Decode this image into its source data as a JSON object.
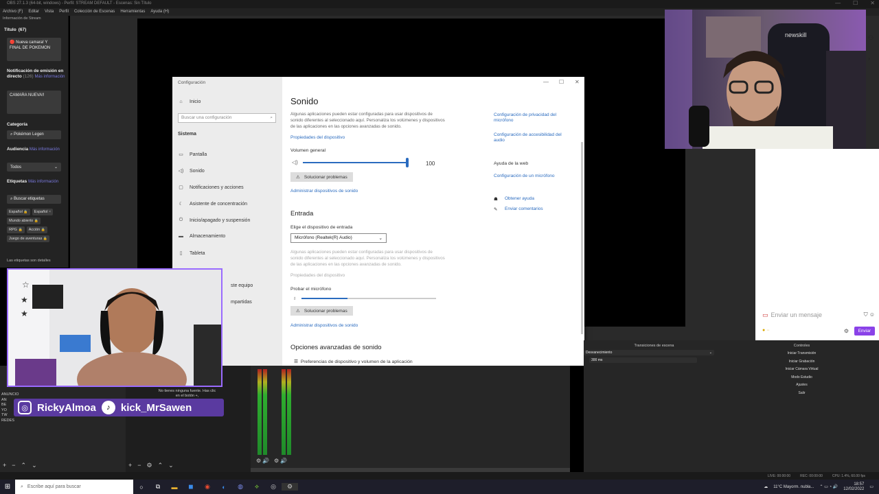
{
  "obs": {
    "title": "OBS 27.1.3 (64-bit, windows) - Perfil: STREAM DEFAULT - Escenas: Sin Título",
    "menu": [
      "Archivo (F)",
      "Editar",
      "Vista",
      "Perfil",
      "Colección de Escenas",
      "Herramientas",
      "Ayuda (H)"
    ]
  },
  "stream_info": {
    "header": "Información de Stream",
    "title_label": "Título",
    "title_count": "(67)",
    "title_value": "🔴 Nueva camara! Y FINAL DE POKEMON",
    "notif_label": "Notificación de emisión en directo",
    "notif_count": "(126)",
    "more": "Más información",
    "notif_value": "CAMARA NUEVA!!",
    "category_label": "Categoría",
    "category_value": "Pokémon Legen",
    "audience_label": "Audiencia",
    "audience_value": "Todos",
    "tags_label": "Etiquetas",
    "tags_search": "Buscar etiquetas",
    "tags": [
      "Español",
      "Español",
      "Mundo abierto",
      "RPG",
      "Acción",
      "Juego de aventuras"
    ],
    "tags_note": "Las etiquetas son detalles"
  },
  "settings": {
    "window_title": "Configuración",
    "home": "Inicio",
    "search_placeholder": "Buscar una configuración",
    "section": "Sistema",
    "nav": [
      "Pantalla",
      "Sonido",
      "Notificaciones y acciones",
      "Asistente de concentración",
      "Inicio/apagado y suspensión",
      "Almacenamiento",
      "Tableta"
    ],
    "nav_partial": [
      "ste equipo",
      "mpartidas"
    ],
    "page_title": "Sonido",
    "output_desc": "Algunas aplicaciones pueden estar configuradas para usar dispositivos de sonido diferentes al seleccionado aquí. Personaliza los volúmenes y dispositivos de las aplicaciones en las opciones avanzadas de sonido.",
    "device_props": "Propiedades del dispositivo",
    "volume_label": "Volumen general",
    "volume_value": "100",
    "troubleshoot": "Solucionar problemas",
    "manage_devices": "Administrar dispositivos de sonido",
    "input_header": "Entrada",
    "input_choose": "Elige el dispositivo de entrada",
    "input_device": "Micrófono (Realtek(R) Audio)",
    "input_desc": "Algunas aplicaciones pueden estar configuradas para usar dispositivos de sonido diferentes al seleccionado aquí. Personaliza los volúmenes y dispositivos de las aplicaciones en las opciones avanzadas de sonido.",
    "input_props": "Propiedades del dispositivo",
    "test_mic": "Probar el micrófono",
    "mic_level": 0.34,
    "troubleshoot2": "Solucionar problemas",
    "manage_devices2": "Administrar dispositivos de sonido",
    "advanced_header": "Opciones avanzadas de sonido",
    "app_prefs": "Preferencias de dispositivo y volumen de la aplicación",
    "related": [
      "Configuración de privacidad del micrófono",
      "Configuración de accesibilidad del audio"
    ],
    "web_help_title": "Ayuda de la web",
    "web_help": "Configuración de un micrófono",
    "get_help": "Obtener ayuda",
    "feedback": "Enviar comentarios"
  },
  "overlay": {
    "instagram": "RickyAlmoa",
    "tiktok": "kick_MrSawen",
    "no_source": "No tienes ninguna fuente. Has clic en el botón +,",
    "left_list": [
      "ANUNCIO",
      "AN",
      "BE",
      "YO",
      "TW",
      "REDES"
    ]
  },
  "cam_brand": "newskill",
  "chat": {
    "placeholder": "Enviar un mensaje",
    "send": "Enviar"
  },
  "docks": {
    "transitions": "Transiciones de escena",
    "transition_type": "Desvanecimiento",
    "duration": "300 ms",
    "controls": "Controles",
    "control_buttons": [
      "Iniciar Transmisión",
      "Iniciar Grabación",
      "Iniciar Cámara Virtual",
      "Modo Estudio",
      "Ajustes",
      "Salir"
    ]
  },
  "status": {
    "live": "LIVE: 00:00:00",
    "rec": "REC: 00:00:00",
    "cpu": "CPU: 1.4%, 60.00 fps"
  },
  "taskbar": {
    "search": "Escribe aquí para buscar",
    "weather": "11°C  Mayorm. nubla...",
    "time": "18:57",
    "date": "12/02/2022"
  }
}
